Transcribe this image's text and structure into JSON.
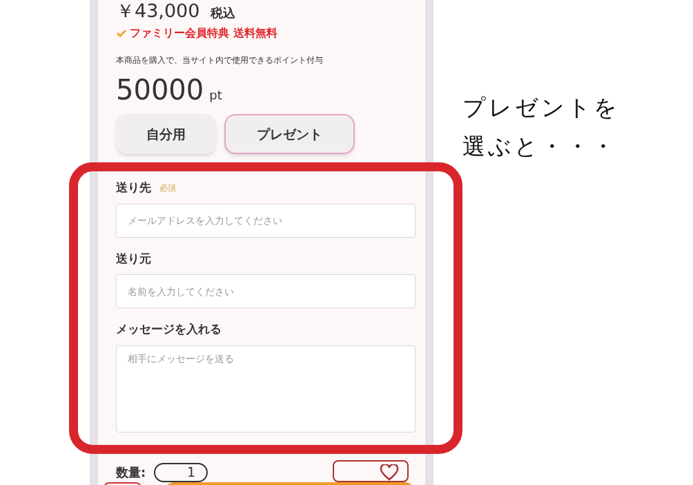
{
  "price": {
    "amount": "￥43,000",
    "tax_note": "税込"
  },
  "perk": {
    "text": "ファミリー会員特典 送料無料",
    "checked": true
  },
  "points_note": "本商品を購入で、当サイト内で使用できるポイント付与",
  "points": {
    "value": "50000",
    "unit": "pt"
  },
  "purpose_tabs": [
    {
      "label": "自分用",
      "selected": false
    },
    {
      "label": "プレゼント",
      "selected": true
    }
  ],
  "form": {
    "fields": [
      {
        "kind": "input",
        "label": "送り先",
        "required_badge": "必須",
        "placeholder": "メールアドレスを入力してください"
      },
      {
        "kind": "input",
        "label": "送り元",
        "placeholder": "名前を入力してください"
      },
      {
        "kind": "textarea",
        "label": "メッセージを入れる",
        "placeholder": "相手にメッセージを送る"
      }
    ]
  },
  "quantity": {
    "label": "数量:",
    "value": "1"
  },
  "annotation": {
    "lines": [
      "プレゼントを",
      "選ぶと・・・"
    ]
  }
}
